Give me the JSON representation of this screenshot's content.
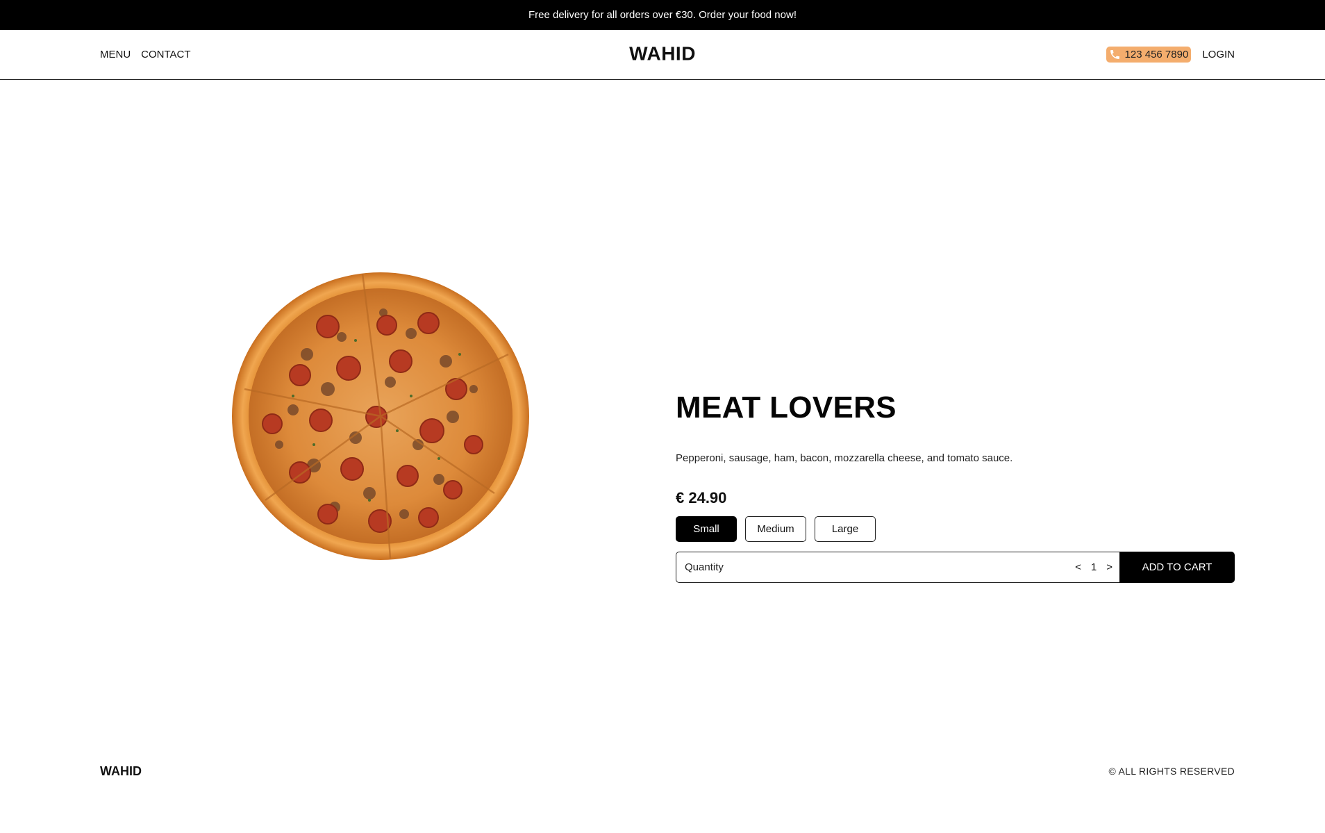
{
  "announcement": "Free delivery for all orders over €30. Order your food now!",
  "header": {
    "nav": [
      {
        "label": "MENU"
      },
      {
        "label": "CONTACT"
      }
    ],
    "logo": "WAHID",
    "phone": "123 456 7890",
    "login_label": "LOGIN",
    "accent_color": "#f4ad6d"
  },
  "product": {
    "title": "MEAT LOVERS",
    "description": "Pepperoni, sausage, ham, bacon, mozzarella cheese, and tomato sauce.",
    "price": "€ 24.90",
    "sizes": [
      {
        "label": "Small",
        "selected": true
      },
      {
        "label": "Medium",
        "selected": false
      },
      {
        "label": "Large",
        "selected": false
      }
    ],
    "quantity_label": "Quantity",
    "quantity_decrement": "<",
    "quantity_value": "1",
    "quantity_increment": ">",
    "add_to_cart_label": "ADD TO CART",
    "image_icon": "pizza-image"
  },
  "footer": {
    "logo": "WAHID",
    "copyright": "© ALL RIGHTS RESERVED"
  }
}
